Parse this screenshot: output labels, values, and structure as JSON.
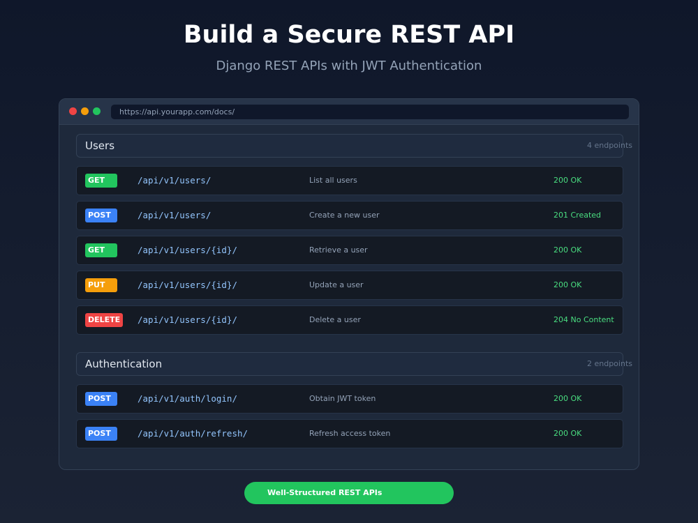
{
  "hero": {
    "title": "Build a Secure REST API",
    "subtitle": "Django REST APIs with JWT Authentication"
  },
  "browser": {
    "url": "https://api.yourapp.com/docs/"
  },
  "sections": [
    {
      "title": "Users",
      "count": "4 endpoints",
      "endpoints": [
        {
          "method": "GET",
          "path": "/api/v1/users/",
          "description": "List all users",
          "status": "200 OK"
        },
        {
          "method": "POST",
          "path": "/api/v1/users/",
          "description": "Create a new user",
          "status": "201 Created"
        },
        {
          "method": "GET",
          "path": "/api/v1/users/{id}/",
          "description": "Retrieve a user",
          "status": "200 OK"
        },
        {
          "method": "PUT",
          "path": "/api/v1/users/{id}/",
          "description": "Update a user",
          "status": "200 OK"
        },
        {
          "method": "DELETE",
          "path": "/api/v1/users/{id}/",
          "description": "Delete a user",
          "status": "204 No Content"
        }
      ]
    },
    {
      "title": "Authentication",
      "count": "2 endpoints",
      "endpoints": [
        {
          "method": "POST",
          "path": "/api/v1/auth/login/",
          "description": "Obtain JWT token",
          "status": "200 OK"
        },
        {
          "method": "POST",
          "path": "/api/v1/auth/refresh/",
          "description": "Refresh access token",
          "status": "200 OK"
        }
      ]
    }
  ],
  "cta": {
    "label": "Well-Structured REST APIs"
  },
  "colors": {
    "get": "#22c55e",
    "post": "#3b82f6",
    "put": "#f59e0b",
    "delete": "#ef4444",
    "status_ok": "#4ade80",
    "cta": "#22c55e"
  }
}
